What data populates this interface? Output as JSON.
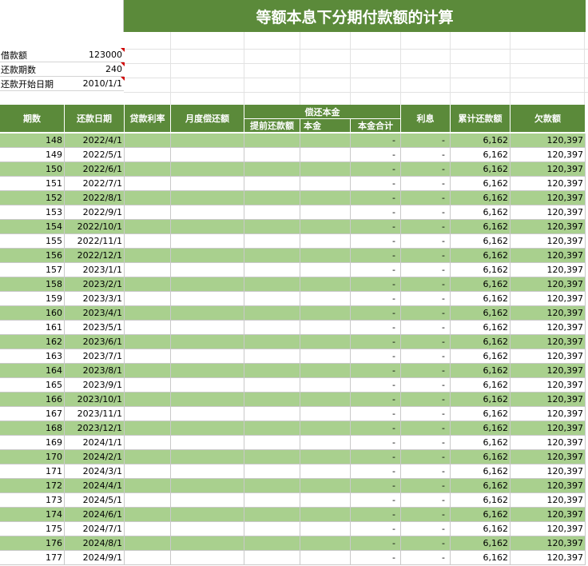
{
  "title": "等额本息下分期付款额的计算",
  "info": [
    {
      "label": "借款额",
      "value": "123000"
    },
    {
      "label": "还款期数",
      "value": "240"
    },
    {
      "label": "还款开始日期",
      "value": "2010/1/1"
    }
  ],
  "headers": {
    "period": "期数",
    "date": "还款日期",
    "rate": "贷款利率",
    "monthly": "月度偿还额",
    "principal_group": "偿还本金",
    "prepay": "提前还款额",
    "principal": "本金",
    "principal_total": "本金合计",
    "interest": "利息",
    "cumulative": "累计还款额",
    "balance": "欠款额"
  },
  "rows": [
    {
      "period": "148",
      "date": "2022/4/1",
      "principal_total": "-",
      "interest": "-",
      "cumulative": "6,162",
      "balance": "120,397"
    },
    {
      "period": "149",
      "date": "2022/5/1",
      "principal_total": "-",
      "interest": "-",
      "cumulative": "6,162",
      "balance": "120,397"
    },
    {
      "period": "150",
      "date": "2022/6/1",
      "principal_total": "-",
      "interest": "-",
      "cumulative": "6,162",
      "balance": "120,397"
    },
    {
      "period": "151",
      "date": "2022/7/1",
      "principal_total": "-",
      "interest": "-",
      "cumulative": "6,162",
      "balance": "120,397"
    },
    {
      "period": "152",
      "date": "2022/8/1",
      "principal_total": "-",
      "interest": "-",
      "cumulative": "6,162",
      "balance": "120,397"
    },
    {
      "period": "153",
      "date": "2022/9/1",
      "principal_total": "-",
      "interest": "-",
      "cumulative": "6,162",
      "balance": "120,397"
    },
    {
      "period": "154",
      "date": "2022/10/1",
      "principal_total": "-",
      "interest": "-",
      "cumulative": "6,162",
      "balance": "120,397"
    },
    {
      "period": "155",
      "date": "2022/11/1",
      "principal_total": "-",
      "interest": "-",
      "cumulative": "6,162",
      "balance": "120,397"
    },
    {
      "period": "156",
      "date": "2022/12/1",
      "principal_total": "-",
      "interest": "-",
      "cumulative": "6,162",
      "balance": "120,397"
    },
    {
      "period": "157",
      "date": "2023/1/1",
      "principal_total": "-",
      "interest": "-",
      "cumulative": "6,162",
      "balance": "120,397"
    },
    {
      "period": "158",
      "date": "2023/2/1",
      "principal_total": "-",
      "interest": "-",
      "cumulative": "6,162",
      "balance": "120,397"
    },
    {
      "period": "159",
      "date": "2023/3/1",
      "principal_total": "-",
      "interest": "-",
      "cumulative": "6,162",
      "balance": "120,397"
    },
    {
      "period": "160",
      "date": "2023/4/1",
      "principal_total": "-",
      "interest": "-",
      "cumulative": "6,162",
      "balance": "120,397"
    },
    {
      "period": "161",
      "date": "2023/5/1",
      "principal_total": "-",
      "interest": "-",
      "cumulative": "6,162",
      "balance": "120,397"
    },
    {
      "period": "162",
      "date": "2023/6/1",
      "principal_total": "-",
      "interest": "-",
      "cumulative": "6,162",
      "balance": "120,397"
    },
    {
      "period": "163",
      "date": "2023/7/1",
      "principal_total": "-",
      "interest": "-",
      "cumulative": "6,162",
      "balance": "120,397"
    },
    {
      "period": "164",
      "date": "2023/8/1",
      "principal_total": "-",
      "interest": "-",
      "cumulative": "6,162",
      "balance": "120,397"
    },
    {
      "period": "165",
      "date": "2023/9/1",
      "principal_total": "-",
      "interest": "-",
      "cumulative": "6,162",
      "balance": "120,397"
    },
    {
      "period": "166",
      "date": "2023/10/1",
      "principal_total": "-",
      "interest": "-",
      "cumulative": "6,162",
      "balance": "120,397"
    },
    {
      "period": "167",
      "date": "2023/11/1",
      "principal_total": "-",
      "interest": "-",
      "cumulative": "6,162",
      "balance": "120,397"
    },
    {
      "period": "168",
      "date": "2023/12/1",
      "principal_total": "-",
      "interest": "-",
      "cumulative": "6,162",
      "balance": "120,397"
    },
    {
      "period": "169",
      "date": "2024/1/1",
      "principal_total": "-",
      "interest": "-",
      "cumulative": "6,162",
      "balance": "120,397"
    },
    {
      "period": "170",
      "date": "2024/2/1",
      "principal_total": "-",
      "interest": "-",
      "cumulative": "6,162",
      "balance": "120,397"
    },
    {
      "period": "171",
      "date": "2024/3/1",
      "principal_total": "-",
      "interest": "-",
      "cumulative": "6,162",
      "balance": "120,397"
    },
    {
      "period": "172",
      "date": "2024/4/1",
      "principal_total": "-",
      "interest": "-",
      "cumulative": "6,162",
      "balance": "120,397"
    },
    {
      "period": "173",
      "date": "2024/5/1",
      "principal_total": "-",
      "interest": "-",
      "cumulative": "6,162",
      "balance": "120,397"
    },
    {
      "period": "174",
      "date": "2024/6/1",
      "principal_total": "-",
      "interest": "-",
      "cumulative": "6,162",
      "balance": "120,397"
    },
    {
      "period": "175",
      "date": "2024/7/1",
      "principal_total": "-",
      "interest": "-",
      "cumulative": "6,162",
      "balance": "120,397"
    },
    {
      "period": "176",
      "date": "2024/8/1",
      "principal_total": "-",
      "interest": "-",
      "cumulative": "6,162",
      "balance": "120,397"
    },
    {
      "period": "177",
      "date": "2024/9/1",
      "principal_total": "-",
      "interest": "-",
      "cumulative": "6,162",
      "balance": "120,397"
    }
  ],
  "colors": {
    "header_green": "#5b8a3a",
    "row_alt_green": "#a9d08e",
    "comment_red": "#d00000"
  }
}
